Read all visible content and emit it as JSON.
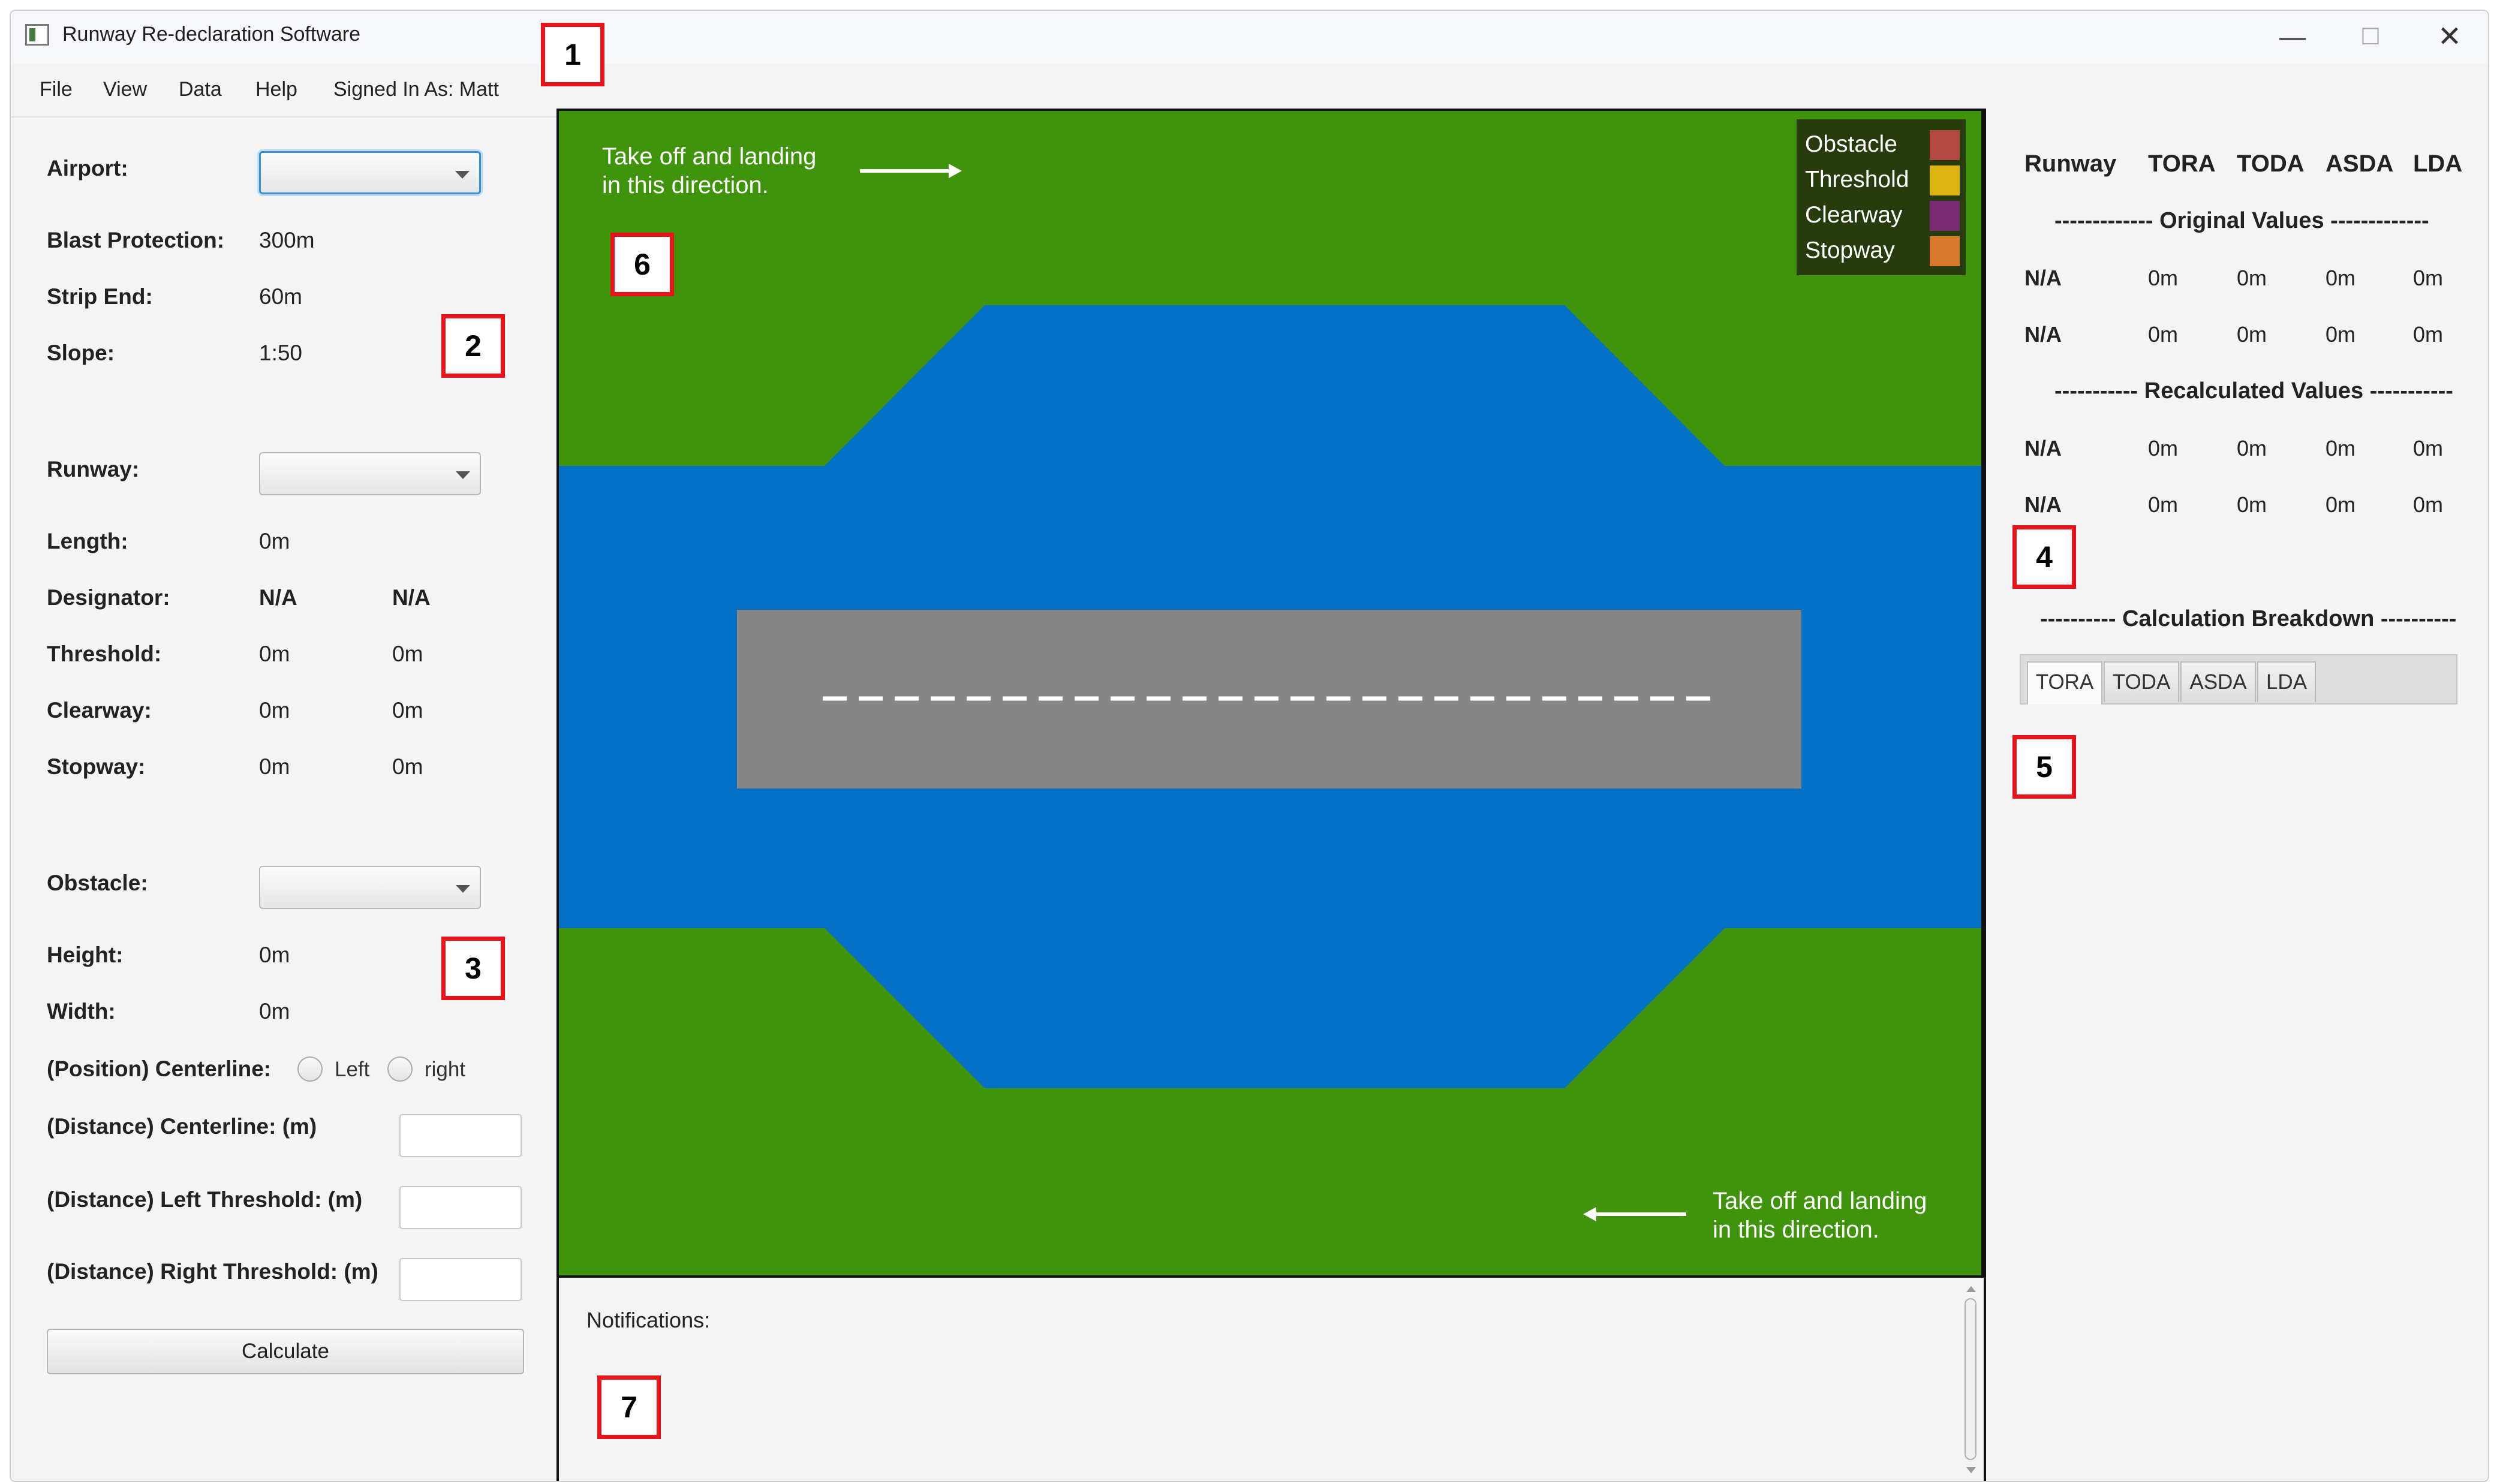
{
  "window": {
    "title": "Runway Re-declaration Software",
    "controls": {
      "minimize": "—",
      "maximize": "☐",
      "close": "✕"
    }
  },
  "menubar": {
    "items": [
      "File",
      "View",
      "Data",
      "Help"
    ],
    "signed_in": "Signed In As: Matt"
  },
  "callouts": [
    "1",
    "2",
    "3",
    "4",
    "5",
    "6",
    "7"
  ],
  "airport": {
    "label": "Airport:",
    "selected": "",
    "blast_label": "Blast Protection:",
    "blast_value": "300m",
    "strip_label": "Strip End:",
    "strip_value": "60m",
    "slope_label": "Slope:",
    "slope_value": "1:50"
  },
  "runway": {
    "label": "Runway:",
    "selected": "",
    "length_label": "Length:",
    "length_value": "0m",
    "designator_label": "Designator:",
    "designator_values": [
      "N/A",
      "N/A"
    ],
    "threshold_label": "Threshold:",
    "threshold_values": [
      "0m",
      "0m"
    ],
    "clearway_label": "Clearway:",
    "clearway_values": [
      "0m",
      "0m"
    ],
    "stopway_label": "Stopway:",
    "stopway_values": [
      "0m",
      "0m"
    ]
  },
  "obstacle": {
    "label": "Obstacle:",
    "selected": "",
    "height_label": "Height:",
    "height_value": "0m",
    "width_label": "Width:",
    "width_value": "0m",
    "position_label": "(Position) Centerline:",
    "position_options": [
      "Left",
      "right"
    ],
    "dist_center_label": "(Distance) Centerline: (m)",
    "dist_center_value": "",
    "dist_left_label": "(Distance) Left Threshold: (m)",
    "dist_left_value": "",
    "dist_right_label": "(Distance) Right Threshold: (m)",
    "dist_right_value": ""
  },
  "calculate_label": "Calculate",
  "view": {
    "direction_top": [
      "Take off and landing",
      "in this direction."
    ],
    "direction_bottom": [
      "Take off and landing",
      "in this direction."
    ],
    "legend": [
      {
        "label": "Obstacle",
        "color": "#b3483f"
      },
      {
        "label": "Threshold",
        "color": "#dcb30f"
      },
      {
        "label": "Clearway",
        "color": "#7a2a73"
      },
      {
        "label": "Stopway",
        "color": "#d9782b"
      }
    ],
    "colors": {
      "grass": "#3f940b",
      "cleared_area": "#0470c6",
      "runway": "#868686",
      "centerline": "#ffffff"
    }
  },
  "notifications": {
    "label": "Notifications:"
  },
  "results": {
    "headers": [
      "Runway",
      "TORA",
      "TODA",
      "ASDA",
      "LDA"
    ],
    "original_title": "------------- Original Values -------------",
    "original_rows": [
      [
        "N/A",
        "0m",
        "0m",
        "0m",
        "0m"
      ],
      [
        "N/A",
        "0m",
        "0m",
        "0m",
        "0m"
      ]
    ],
    "recalc_title": "----------- Recalculated Values -----------",
    "recalc_rows": [
      [
        "N/A",
        "0m",
        "0m",
        "0m",
        "0m"
      ],
      [
        "N/A",
        "0m",
        "0m",
        "0m",
        "0m"
      ]
    ],
    "breakdown_title": "---------- Calculation Breakdown ----------",
    "tabs": [
      "TORA",
      "TODA",
      "ASDA",
      "LDA"
    ],
    "active_tab": "TORA"
  }
}
